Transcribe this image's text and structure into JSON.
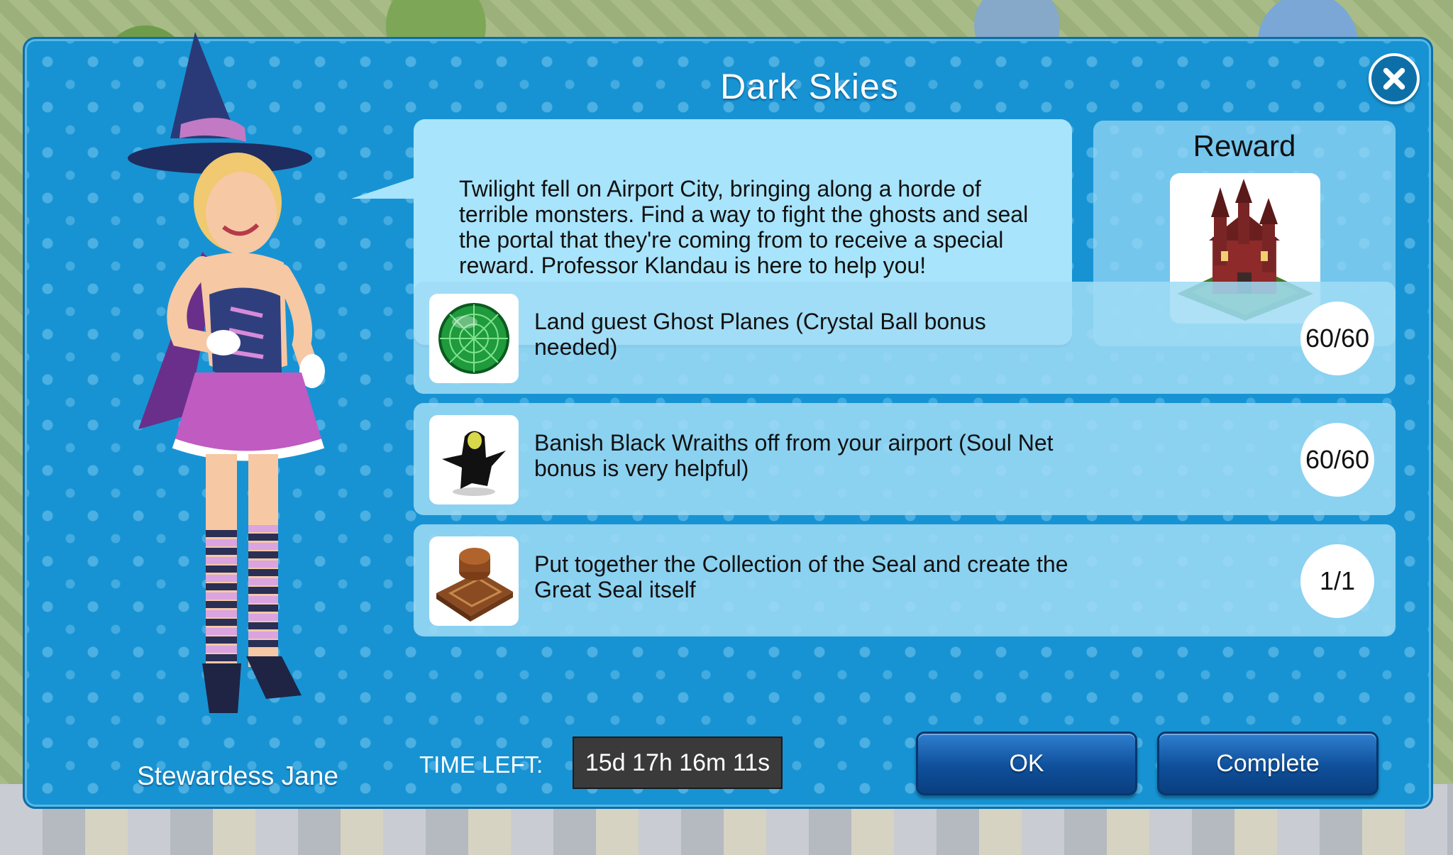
{
  "dialog": {
    "title": "Dark Skies",
    "character_name": "Stewardess Jane",
    "description": "Twilight fell on Airport City, bringing along a horde of terrible monsters. Find a way to fight the ghosts and seal the portal that they're coming from to receive a special reward. Professor Klandau is here to help you!",
    "reward_label": "Reward"
  },
  "tasks": [
    {
      "text": "Land guest Ghost Planes (Crystal Ball bonus needed)",
      "progress": "60/60",
      "icon": "crystal-ball-radar-icon"
    },
    {
      "text": "Banish Black Wraiths off from your airport (Soul Net bonus is very helpful)",
      "progress": "60/60",
      "icon": "black-wraith-icon"
    },
    {
      "text": "Put together the Collection of the Seal and create the Great Seal itself",
      "progress": "1/1",
      "icon": "great-seal-icon"
    }
  ],
  "footer": {
    "time_left_label": "TIME LEFT:",
    "time_left_value": "15d 17h 16m 11s",
    "ok_label": "OK",
    "complete_label": "Complete"
  },
  "colors": {
    "dialog_bg": "#1793d3",
    "speech_bg": "#a8e4fb",
    "button_blue": "#0f4f9a"
  }
}
